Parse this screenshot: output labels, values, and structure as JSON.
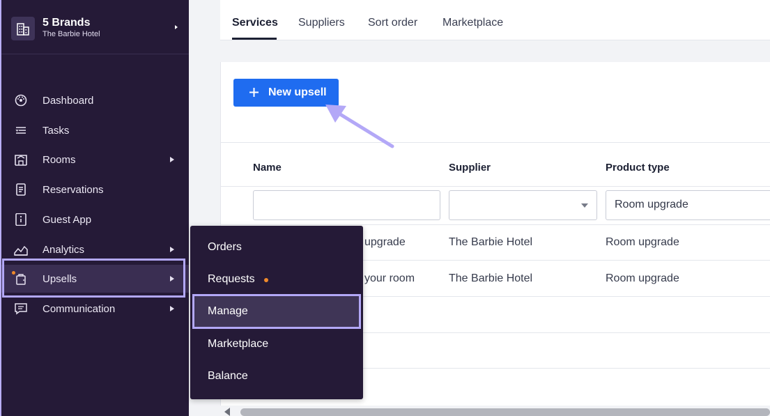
{
  "brand": {
    "title": "5 Brands",
    "subtitle": "The Barbie Hotel"
  },
  "sidebar": {
    "items": [
      {
        "label": "Dashboard",
        "icon": "dashboard-icon",
        "chevron": false
      },
      {
        "label": "Tasks",
        "icon": "tasks-icon",
        "chevron": false
      },
      {
        "label": "Rooms",
        "icon": "rooms-icon",
        "chevron": true
      },
      {
        "label": "Reservations",
        "icon": "reservations-icon",
        "chevron": false
      },
      {
        "label": "Guest App",
        "icon": "guest-app-icon",
        "chevron": false
      },
      {
        "label": "Analytics",
        "icon": "analytics-icon",
        "chevron": true
      },
      {
        "label": "Upsells",
        "icon": "upsells-icon",
        "chevron": true,
        "active": true
      },
      {
        "label": "Communication",
        "icon": "communication-icon",
        "chevron": true
      }
    ]
  },
  "submenu": {
    "items": [
      {
        "label": "Orders"
      },
      {
        "label": "Requests",
        "badge": "orange-dot"
      },
      {
        "label": "Manage",
        "active": true
      },
      {
        "label": "Marketplace"
      },
      {
        "label": "Balance"
      }
    ]
  },
  "tabs": [
    {
      "label": "Services",
      "active": true
    },
    {
      "label": "Suppliers"
    },
    {
      "label": "Sort order"
    },
    {
      "label": "Marketplace"
    }
  ],
  "toolbar": {
    "new_upsell_label": "New upsell"
  },
  "table": {
    "columns": [
      "Name",
      "Supplier",
      "Product type"
    ],
    "filters": {
      "name": "",
      "supplier": "",
      "product_type": "Room upgrade"
    },
    "rows": [
      {
        "name": "upgrade",
        "supplier": "The Barbie Hotel",
        "product_type": "Room upgrade"
      },
      {
        "name": "your room",
        "supplier": "The Barbie Hotel",
        "product_type": "Room upgrade"
      }
    ]
  },
  "colors": {
    "sidebar_bg": "#251a37",
    "accent": "#1f6cf0",
    "highlight": "#b3a8f7",
    "badge": "#ef8a2b"
  }
}
